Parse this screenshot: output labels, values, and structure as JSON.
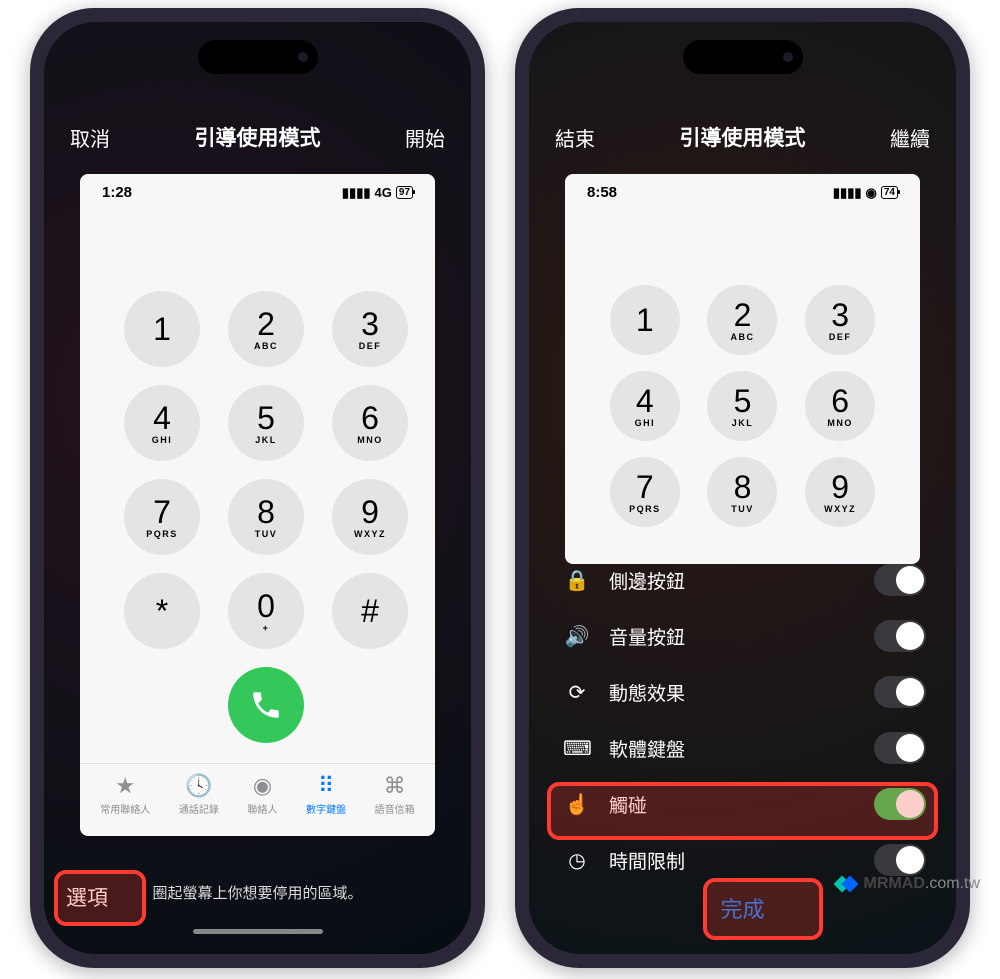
{
  "left": {
    "nav": {
      "cancel": "取消",
      "title": "引導使用模式",
      "start": "開始"
    },
    "status": {
      "time": "1:28",
      "net": "4G",
      "battery": "97"
    },
    "keypad": [
      {
        "digit": "1",
        "letters": ""
      },
      {
        "digit": "2",
        "letters": "ABC"
      },
      {
        "digit": "3",
        "letters": "DEF"
      },
      {
        "digit": "4",
        "letters": "GHI"
      },
      {
        "digit": "5",
        "letters": "JKL"
      },
      {
        "digit": "6",
        "letters": "MNO"
      },
      {
        "digit": "7",
        "letters": "PQRS"
      },
      {
        "digit": "8",
        "letters": "TUV"
      },
      {
        "digit": "9",
        "letters": "WXYZ"
      },
      {
        "digit": "*",
        "letters": ""
      },
      {
        "digit": "0",
        "letters": "+"
      },
      {
        "digit": "#",
        "letters": ""
      }
    ],
    "tabs": [
      {
        "label": "常用聯絡人"
      },
      {
        "label": "通話記錄"
      },
      {
        "label": "聯絡人"
      },
      {
        "label": "數字鍵盤"
      },
      {
        "label": "語音信箱"
      }
    ],
    "options_btn": "選項",
    "hint": "圈起螢幕上你想要停用的區域。"
  },
  "right": {
    "nav": {
      "end": "結束",
      "title": "引導使用模式",
      "continue": "繼續"
    },
    "status": {
      "time": "8:58",
      "battery": "74"
    },
    "options": [
      {
        "label": "側邊按鈕",
        "on": false
      },
      {
        "label": "音量按鈕",
        "on": false
      },
      {
        "label": "動態效果",
        "on": false
      },
      {
        "label": "軟體鍵盤",
        "on": false
      },
      {
        "label": "觸碰",
        "on": true
      },
      {
        "label": "時間限制",
        "on": false
      }
    ],
    "done": "完成"
  },
  "watermark": {
    "brand": "MRMAD",
    "domain": ".com.tw"
  }
}
